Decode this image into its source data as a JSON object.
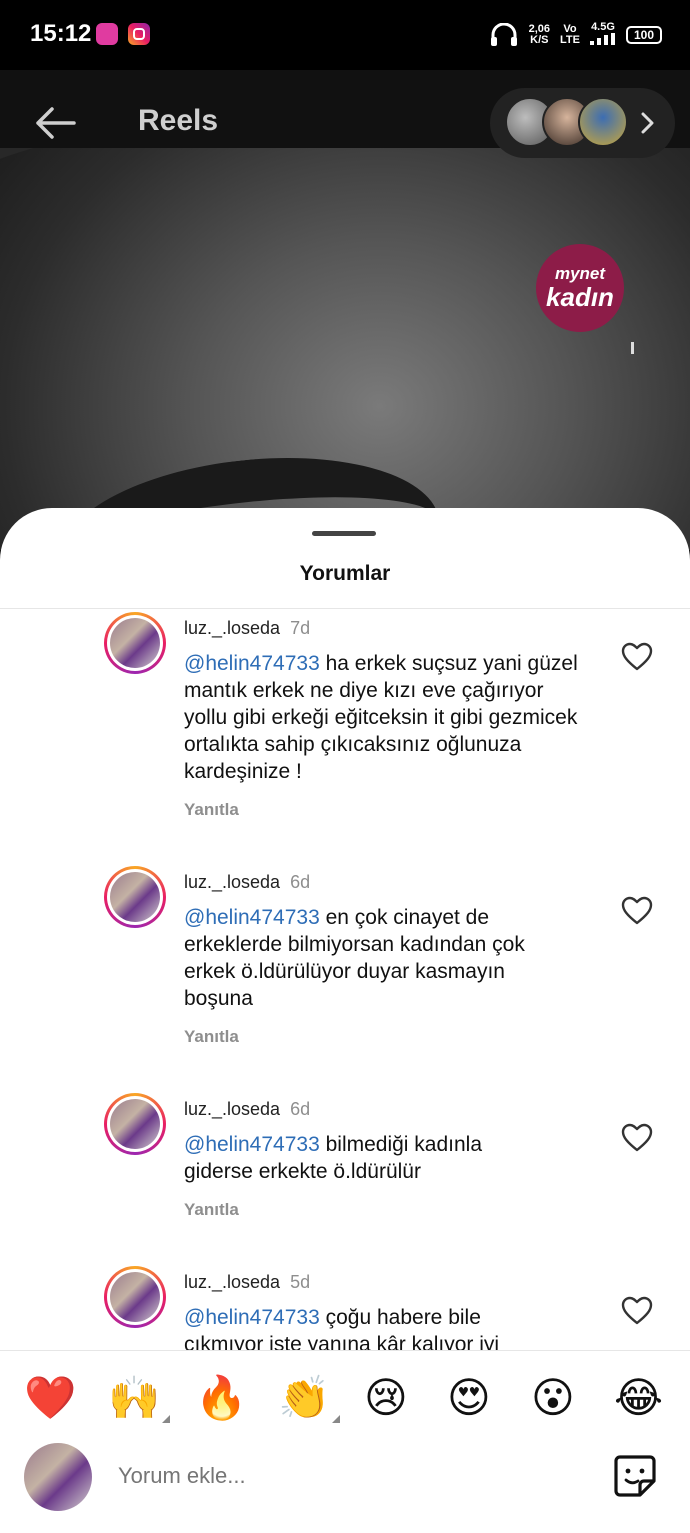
{
  "status_bar": {
    "time": "15:12",
    "net_speed_top": "2,06",
    "net_speed_bottom": "K/S",
    "volte_top": "Vo",
    "volte_bottom": "LTE",
    "network": "4.5G",
    "battery": "100"
  },
  "header": {
    "title": "Reels"
  },
  "video": {
    "badge_line1": "mynet",
    "badge_line2": "kadın"
  },
  "sheet": {
    "title": "Yorumlar",
    "comments": [
      {
        "user": "luz._.loseda",
        "time": "7d",
        "mention": "@helin474733",
        "text": " ha erkek suçsuz yani güzel mantık erkek ne diye kızı eve çağırıyor yollu gibi erkeği eğitceksin it gibi gezmicek ortalıkta sahip çıkıcaksınız oğlunuza kardeşinize !",
        "reply": "Yanıtla"
      },
      {
        "user": "luz._.loseda",
        "time": "6d",
        "mention": "@helin474733",
        "text": " en çok cinayet de erkeklerde bilmiyorsan kadından çok erkek ö.ldürülüyor duyar kasmayın boşuna",
        "reply": "Yanıtla"
      },
      {
        "user": "luz._.loseda",
        "time": "6d",
        "mention": "@helin474733",
        "text": " bilmediği kadınla giderse erkekte ö.ldürülür",
        "reply": "Yanıtla"
      },
      {
        "user": "luz._.loseda",
        "time": "5d",
        "mention": "@helin474733",
        "text": " çoğu habere bile çıkmıyor iste yanına kâr kalıyor iyi"
      }
    ]
  },
  "reactions": [
    "❤️",
    "🙌",
    "🔥",
    "👏",
    "😢",
    "😍",
    "😮",
    "😂"
  ],
  "composer": {
    "placeholder": "Yorum ekle..."
  }
}
